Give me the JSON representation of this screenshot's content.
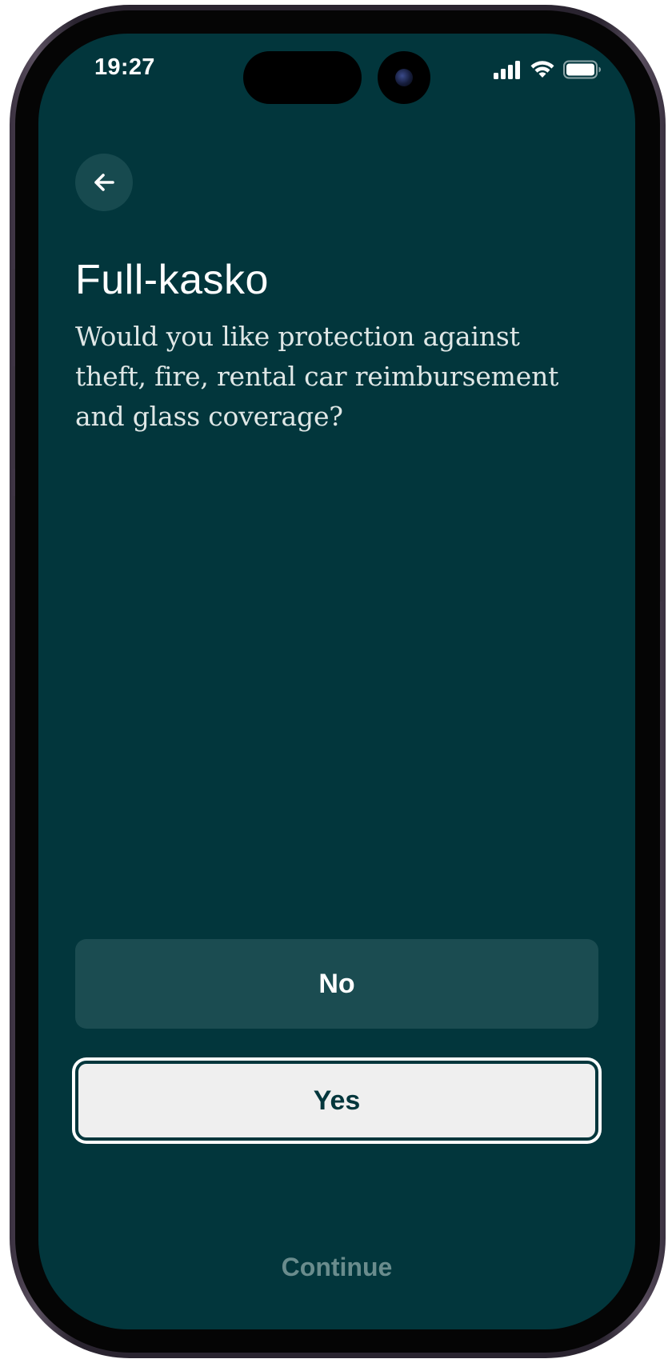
{
  "status_bar": {
    "time": "19:27",
    "icons": [
      "signal-icon",
      "wifi-icon",
      "battery-icon"
    ]
  },
  "navigation": {
    "back_icon": "arrow-left-icon"
  },
  "content": {
    "title": "Full-kasko",
    "question": "Would you like protection against theft, fire, rental car reimbursement and glass coverage?"
  },
  "options": {
    "no_label": "No",
    "yes_label": "Yes",
    "selected": "Yes"
  },
  "footer": {
    "continue_label": "Continue"
  },
  "colors": {
    "background": "#02363c",
    "secondary_button": "#1b4c51",
    "selected_button": "#efefef",
    "disabled_text": "#6a8c8d"
  }
}
